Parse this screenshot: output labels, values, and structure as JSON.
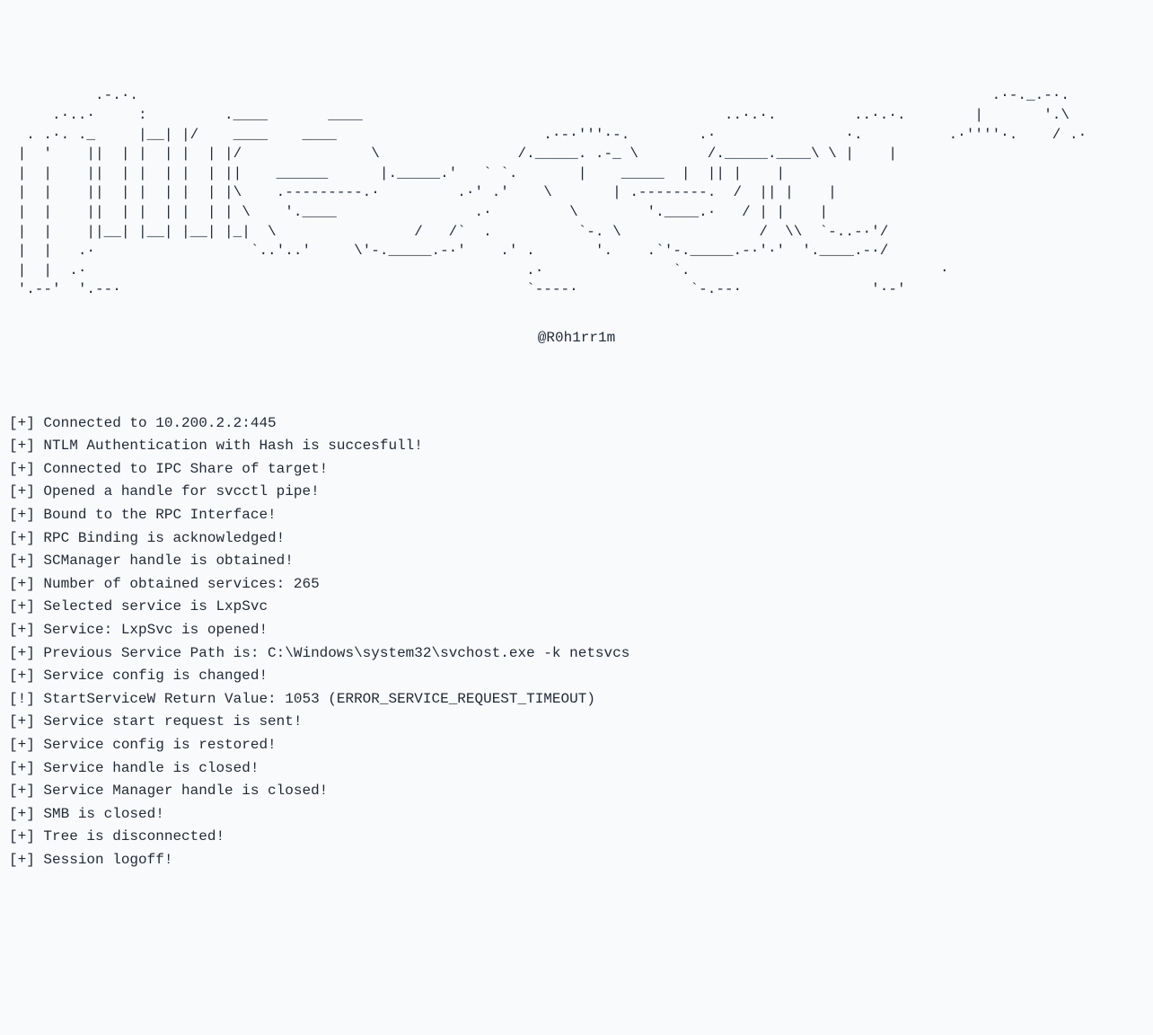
{
  "ascii_art": "          .-.·.                                                                                                   .·-._.-·.\n     .·..·     :         .____       ____                                          ..·.·.         ..·.·.        |       '.\\\n  . .·. ._     |__| |/    ____    ____                        .·-·'''·-.        .·               ·.          .·''''·.    / .·\n |  '    ||  | |  | |  | |/               \\                /._____. .-_ \\        /._____.____\\ \\ |    |\n |  |    ||  | |  | |  | ||    ______      |._____.'   ` `.       |    _____  |  || |    |\n |  |    ||  | |  | |  | |\\    .---------.·         .·' .'    \\       | .--------.  /  || |    |\n |  |    ||  | |  | |  | | \\    '.____                .·         \\        '.____.·   / | |    |\n |  |    ||__| |__| |__| |_|  \\                /   /`  .          `-. \\                /  \\\\  `-..-·'/\n |  |   .·                  `..'..'     \\'-._____.-·'    .' .       '.    .`'-._____.-·'·'  '.____.-·/\n |  |  .·                                                   .·               `.                             ·\n '.--'  '.--·                                               `----·             `-.--·               '·-'",
  "author": "@R0h1rr1m",
  "log_lines": [
    {
      "prefix": "[+]",
      "message": "Connected to 10.200.2.2:445"
    },
    {
      "prefix": "[+]",
      "message": "NTLM Authentication with Hash is succesfull!"
    },
    {
      "prefix": "[+]",
      "message": "Connected to IPC Share of target!"
    },
    {
      "prefix": "[+]",
      "message": "Opened a handle for svcctl pipe!"
    },
    {
      "prefix": "[+]",
      "message": "Bound to the RPC Interface!"
    },
    {
      "prefix": "[+]",
      "message": "RPC Binding is acknowledged!"
    },
    {
      "prefix": "[+]",
      "message": "SCManager handle is obtained!"
    },
    {
      "prefix": "[+]",
      "message": "Number of obtained services: 265"
    },
    {
      "prefix": "[+]",
      "message": "Selected service is LxpSvc"
    },
    {
      "prefix": "[+]",
      "message": "Service: LxpSvc is opened!"
    },
    {
      "prefix": "[+]",
      "message": "Previous Service Path is: C:\\Windows\\system32\\svchost.exe -k netsvcs"
    },
    {
      "prefix": "[+]",
      "message": "Service config is changed!"
    },
    {
      "prefix": "[!]",
      "message": "StartServiceW Return Value: 1053 (ERROR_SERVICE_REQUEST_TIMEOUT)"
    },
    {
      "prefix": "[+]",
      "message": "Service start request is sent!"
    },
    {
      "prefix": "[+]",
      "message": "Service config is restored!"
    },
    {
      "prefix": "[+]",
      "message": "Service handle is closed!"
    },
    {
      "prefix": "[+]",
      "message": "Service Manager handle is closed!"
    },
    {
      "prefix": "[+]",
      "message": "SMB is closed!"
    },
    {
      "prefix": "[+]",
      "message": "Tree is disconnected!"
    },
    {
      "prefix": "[+]",
      "message": "Session logoff!"
    }
  ]
}
